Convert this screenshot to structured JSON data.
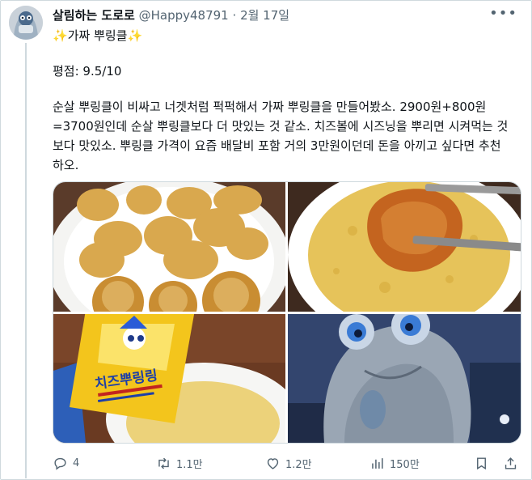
{
  "tweet": {
    "display_name": "살림하는 도로로",
    "handle": "@Happy48791",
    "separator": "·",
    "date": "2월 17일",
    "more_icon": "more-horizontal-icon",
    "title": "✨가짜 뿌링클✨",
    "rating": "평점: 9.5/10",
    "body": "순살 뿌링클이 비싸고 너겟처럼 퍽퍽해서 가짜 뿌링클을 만들어봤소. 2900원+800원\n=3700원인데 순살 뿌링클보다 더 맛있는 것 같소. 치즈볼에 시즈닝을 뿌리면 시켜먹는 것\n보다 맛있소. 뿌링클 가격이 요즘 배달비 포함 거의 3만원이던데 돈을 아끼고 싶다면 추천\n하오."
  },
  "media": {
    "photos": [
      {
        "name": "photo-chicken-plate",
        "icon": "photo"
      },
      {
        "name": "photo-chicken-seasoning",
        "icon": "photo"
      },
      {
        "name": "photo-seasoning-packet",
        "icon": "photo",
        "packet_text": "치즈뿌링링"
      },
      {
        "name": "photo-anime-character",
        "icon": "photo"
      }
    ]
  },
  "actions": {
    "reply_count": "4",
    "retweet_count": "1.1만",
    "like_count": "1.2만",
    "view_count": "150만"
  },
  "colors": {
    "text": "#0f1419",
    "muted": "#536471",
    "border": "#cfd9de"
  }
}
